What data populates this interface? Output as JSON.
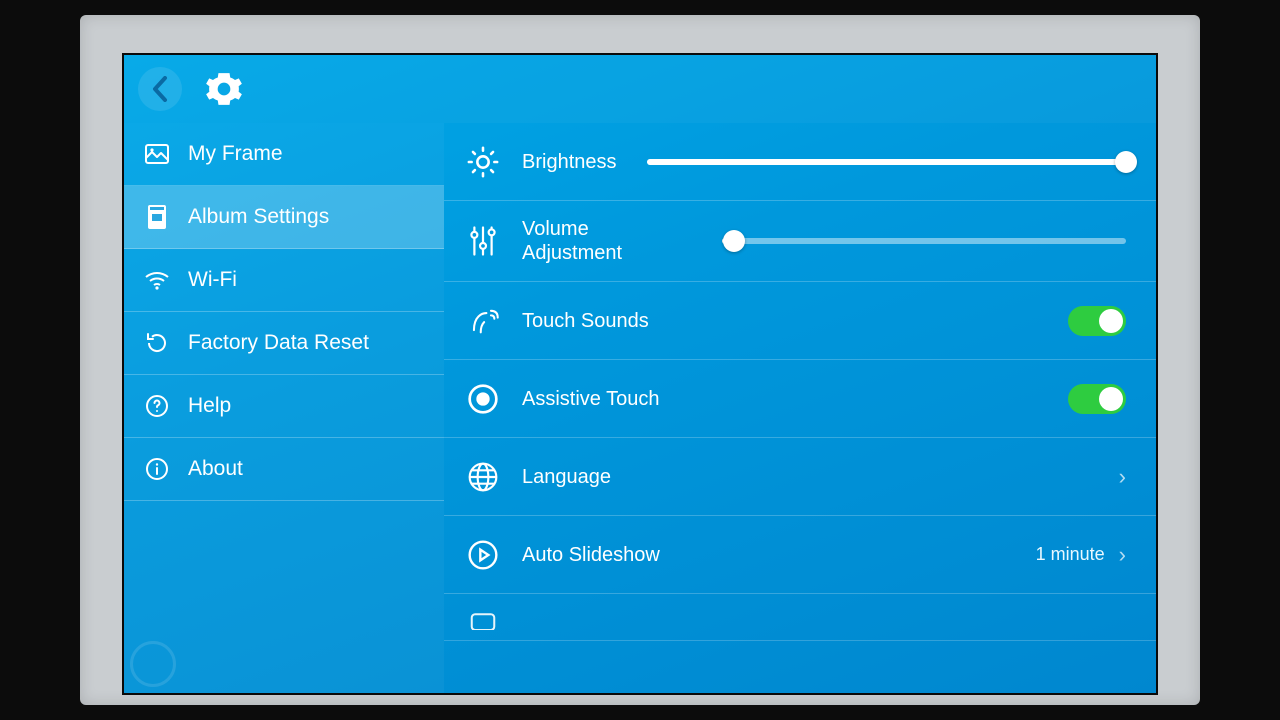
{
  "sidebar": {
    "items": [
      {
        "label": "My Frame",
        "icon": "picture-icon"
      },
      {
        "label": "Album Settings",
        "icon": "album-icon",
        "active": true
      },
      {
        "label": "Wi-Fi",
        "icon": "wifi-icon"
      },
      {
        "label": "Factory Data Reset",
        "icon": "reset-icon"
      },
      {
        "label": "Help",
        "icon": "help-icon"
      },
      {
        "label": "About",
        "icon": "info-icon"
      }
    ]
  },
  "settings": {
    "brightness": {
      "label": "Brightness",
      "value_percent": 100
    },
    "volume": {
      "label": "Volume Adjustment",
      "value_percent": 3
    },
    "touch_sounds": {
      "label": "Touch Sounds",
      "on": true
    },
    "assistive_touch": {
      "label": "Assistive Touch",
      "on": true
    },
    "language": {
      "label": "Language"
    },
    "auto_slideshow": {
      "label": "Auto Slideshow",
      "value": "1 minute"
    }
  },
  "colors": {
    "bg_primary": "#009ade",
    "toggle_on": "#2ecc40"
  }
}
